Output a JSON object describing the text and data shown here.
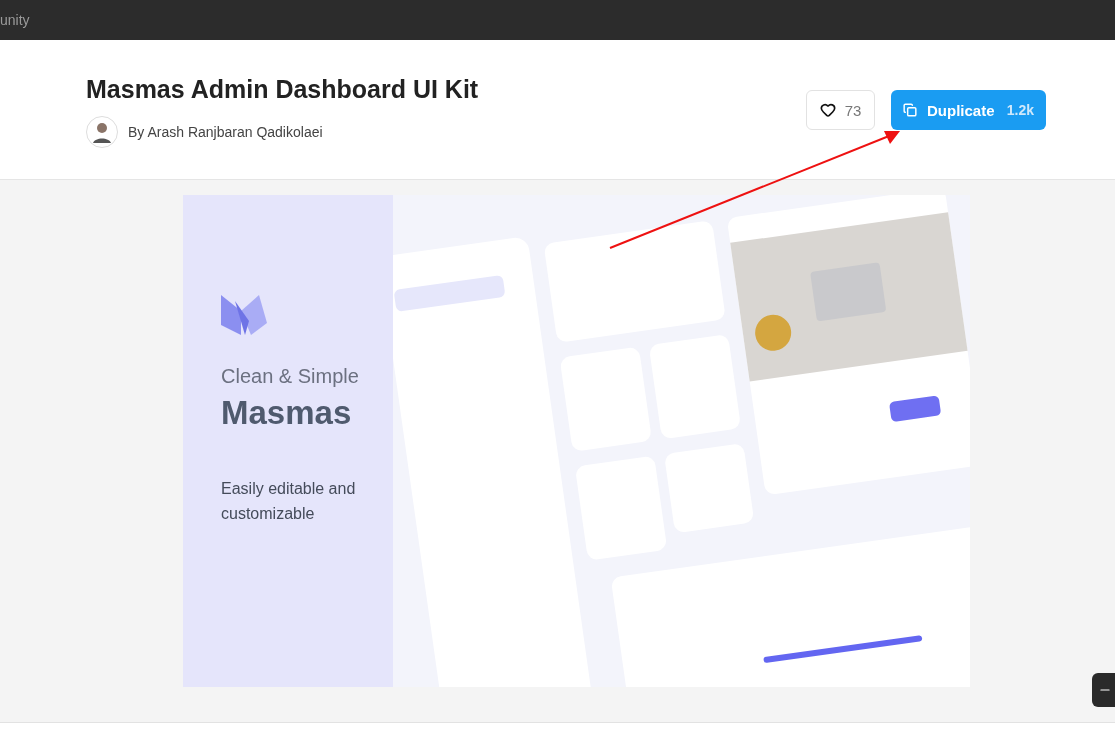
{
  "top_bar": {
    "label": "unity"
  },
  "header": {
    "title": "Masmas Admin Dashboard UI Kit",
    "author": "By Arash Ranjbaran Qadikolaei",
    "like_button": {
      "count": "73"
    },
    "duplicate_button": {
      "label": "Duplicate",
      "count": "1.2k"
    }
  },
  "preview": {
    "tagline": "Clean & Simple",
    "name": "Masmas",
    "description": "Easily editable and customizable"
  }
}
